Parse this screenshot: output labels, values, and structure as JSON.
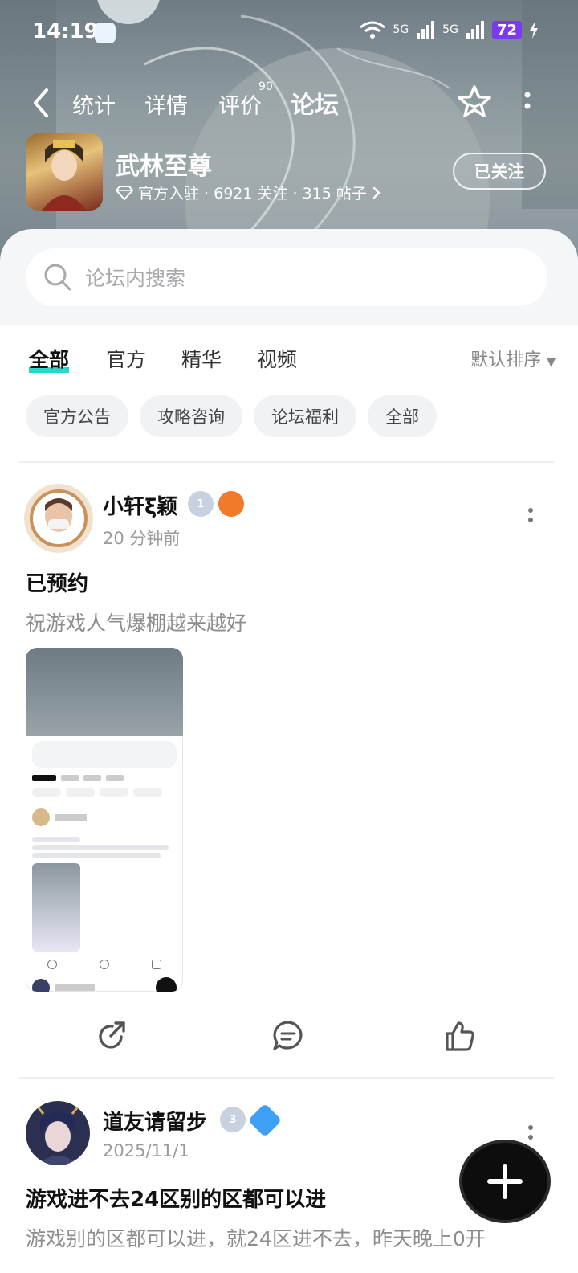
{
  "status": {
    "time": "14:19",
    "signal1": "5G",
    "signal2": "5G",
    "battery": "72"
  },
  "nav": {
    "tabs": [
      "统计",
      "详情",
      "评价",
      "论坛"
    ],
    "active_tab": "论坛",
    "review_count": "90"
  },
  "game": {
    "name": "武林至尊",
    "meta": "官方入驻 · 6921 关注 · 315 帖子",
    "follow_label": "已关注"
  },
  "search": {
    "placeholder": "论坛内搜索"
  },
  "filter_tabs": [
    "全部",
    "官方",
    "精华",
    "视频"
  ],
  "sort_label": "默认排序",
  "chips": [
    "官方公告",
    "攻略咨询",
    "论坛福利",
    "全部"
  ],
  "posts": [
    {
      "username": "小轩ξ颖",
      "level": "1",
      "time": "20 分钟前",
      "title": "已预约",
      "body": "祝游戏人气爆棚越来越好"
    },
    {
      "username": "道友请留步",
      "level": "3",
      "time": "2025/11/1",
      "title": "游戏进不去24区别的区都可以进",
      "body": "游戏别的区都可以进，就24区进不去，昨天晚上0开"
    }
  ],
  "colors": {
    "accent": "#27d9c8",
    "battery": "#7c3aed"
  }
}
